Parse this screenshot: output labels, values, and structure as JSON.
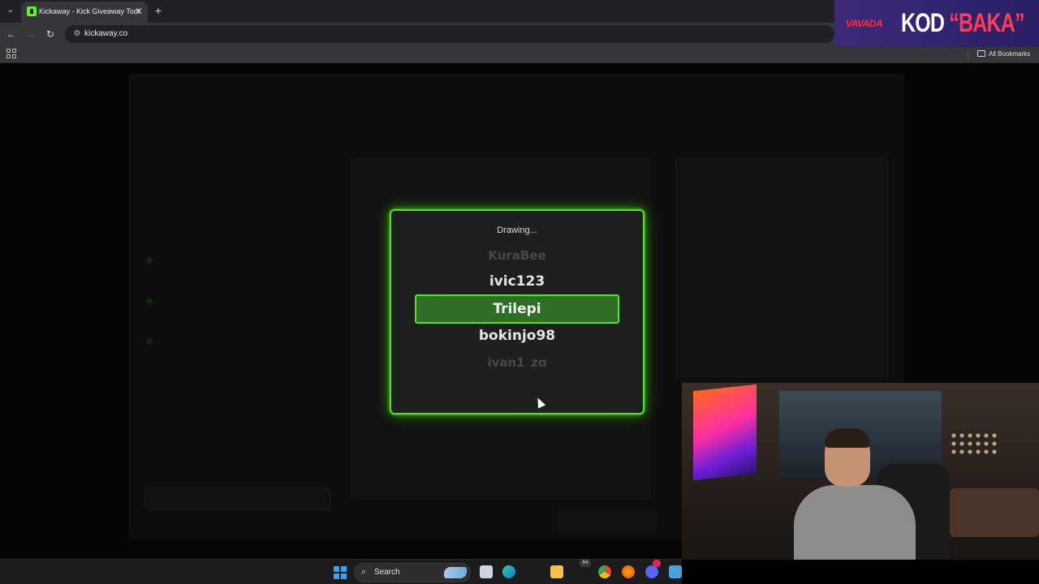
{
  "browser": {
    "tab_title": "Kickaway - Kick Giveaway Tool",
    "tab_close": "✕",
    "new_tab": "+",
    "url": "kickaway.co",
    "bookmarks_label": "All Bookmarks"
  },
  "ad": {
    "brand": "VAVADA",
    "code_text": "KOD",
    "code_value": "BAKA"
  },
  "modal": {
    "title": "Drawing...",
    "names": [
      "KuraBee",
      "ivic123",
      "Trilepi",
      "bokinjo98",
      "ivan1_zg"
    ],
    "selected_index": 2
  },
  "taskbar": {
    "search_label": "Search",
    "notification_count": "64"
  },
  "colors": {
    "accent_green": "#53e41c",
    "highlight_fill": "#2f6d29",
    "modal_bg": "#1e1f1f"
  }
}
